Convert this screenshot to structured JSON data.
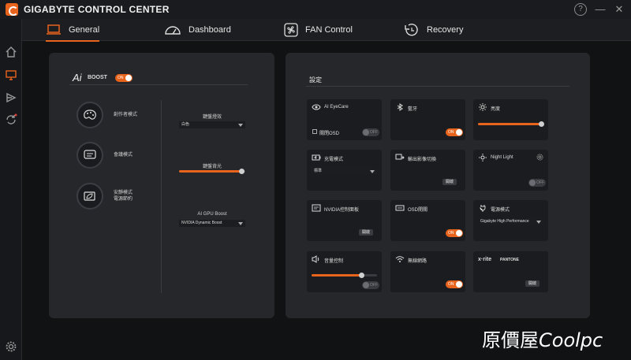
{
  "app": {
    "title": "GIGABYTE CONTROL CENTER",
    "help": "?",
    "minimize": "—",
    "close": "✕"
  },
  "tabs": [
    {
      "label": "General",
      "icon": "laptop-icon"
    },
    {
      "label": "Dashboard",
      "icon": "gauge-icon"
    },
    {
      "label": "FAN Control",
      "icon": "fan-icon"
    },
    {
      "label": "Recovery",
      "icon": "recovery-icon"
    }
  ],
  "left": {
    "ai_label": "Ai",
    "boost_label": "BOOST",
    "boost_toggle": "ON",
    "modes": [
      {
        "label": "創作者模式"
      },
      {
        "label": "會議模式"
      },
      {
        "label": "安靜模式",
        "label2": "電源節約"
      }
    ],
    "keyboard_effect": {
      "title": "鍵盤燈效",
      "value": "白色"
    },
    "keyboard_backlight": {
      "title": "鍵盤背光",
      "level": 0.95
    },
    "gpu_boost": {
      "title": "AI GPU Boost",
      "value": "NVIDIA Dynamic Boost"
    }
  },
  "settings": {
    "title": "設定",
    "cards": {
      "eyecare": {
        "label": "AI EyeCare",
        "check_label": "關閉OSD",
        "toggle": "OFF"
      },
      "bluetooth": {
        "label": "藍牙",
        "toggle": "ON"
      },
      "brightness": {
        "label": "亮度",
        "level": 0.98
      },
      "charging": {
        "label": "充電模式",
        "value": "標準"
      },
      "display_switch": {
        "label": "輸出影像切換",
        "button": "開啟"
      },
      "nightlight": {
        "label": "Night Light",
        "toggle": "OFF"
      },
      "nvidia": {
        "label": "NVIDIA控制面板",
        "button": "開啟"
      },
      "osd": {
        "label": "OSD開關",
        "toggle": "ON"
      },
      "power": {
        "label": "電源模式",
        "value": "Gigabyte High Performance"
      },
      "volume": {
        "label": "音量控制",
        "level": 0.77,
        "toggle": "OFF"
      },
      "wifi": {
        "label": "無線網路",
        "toggle": "ON"
      },
      "xrite": {
        "brand1": "x·rite",
        "brand2": "PANTONE",
        "button": "開啟"
      }
    }
  },
  "watermark": {
    "part1": "原價屋",
    "part2": "Coolpc"
  }
}
